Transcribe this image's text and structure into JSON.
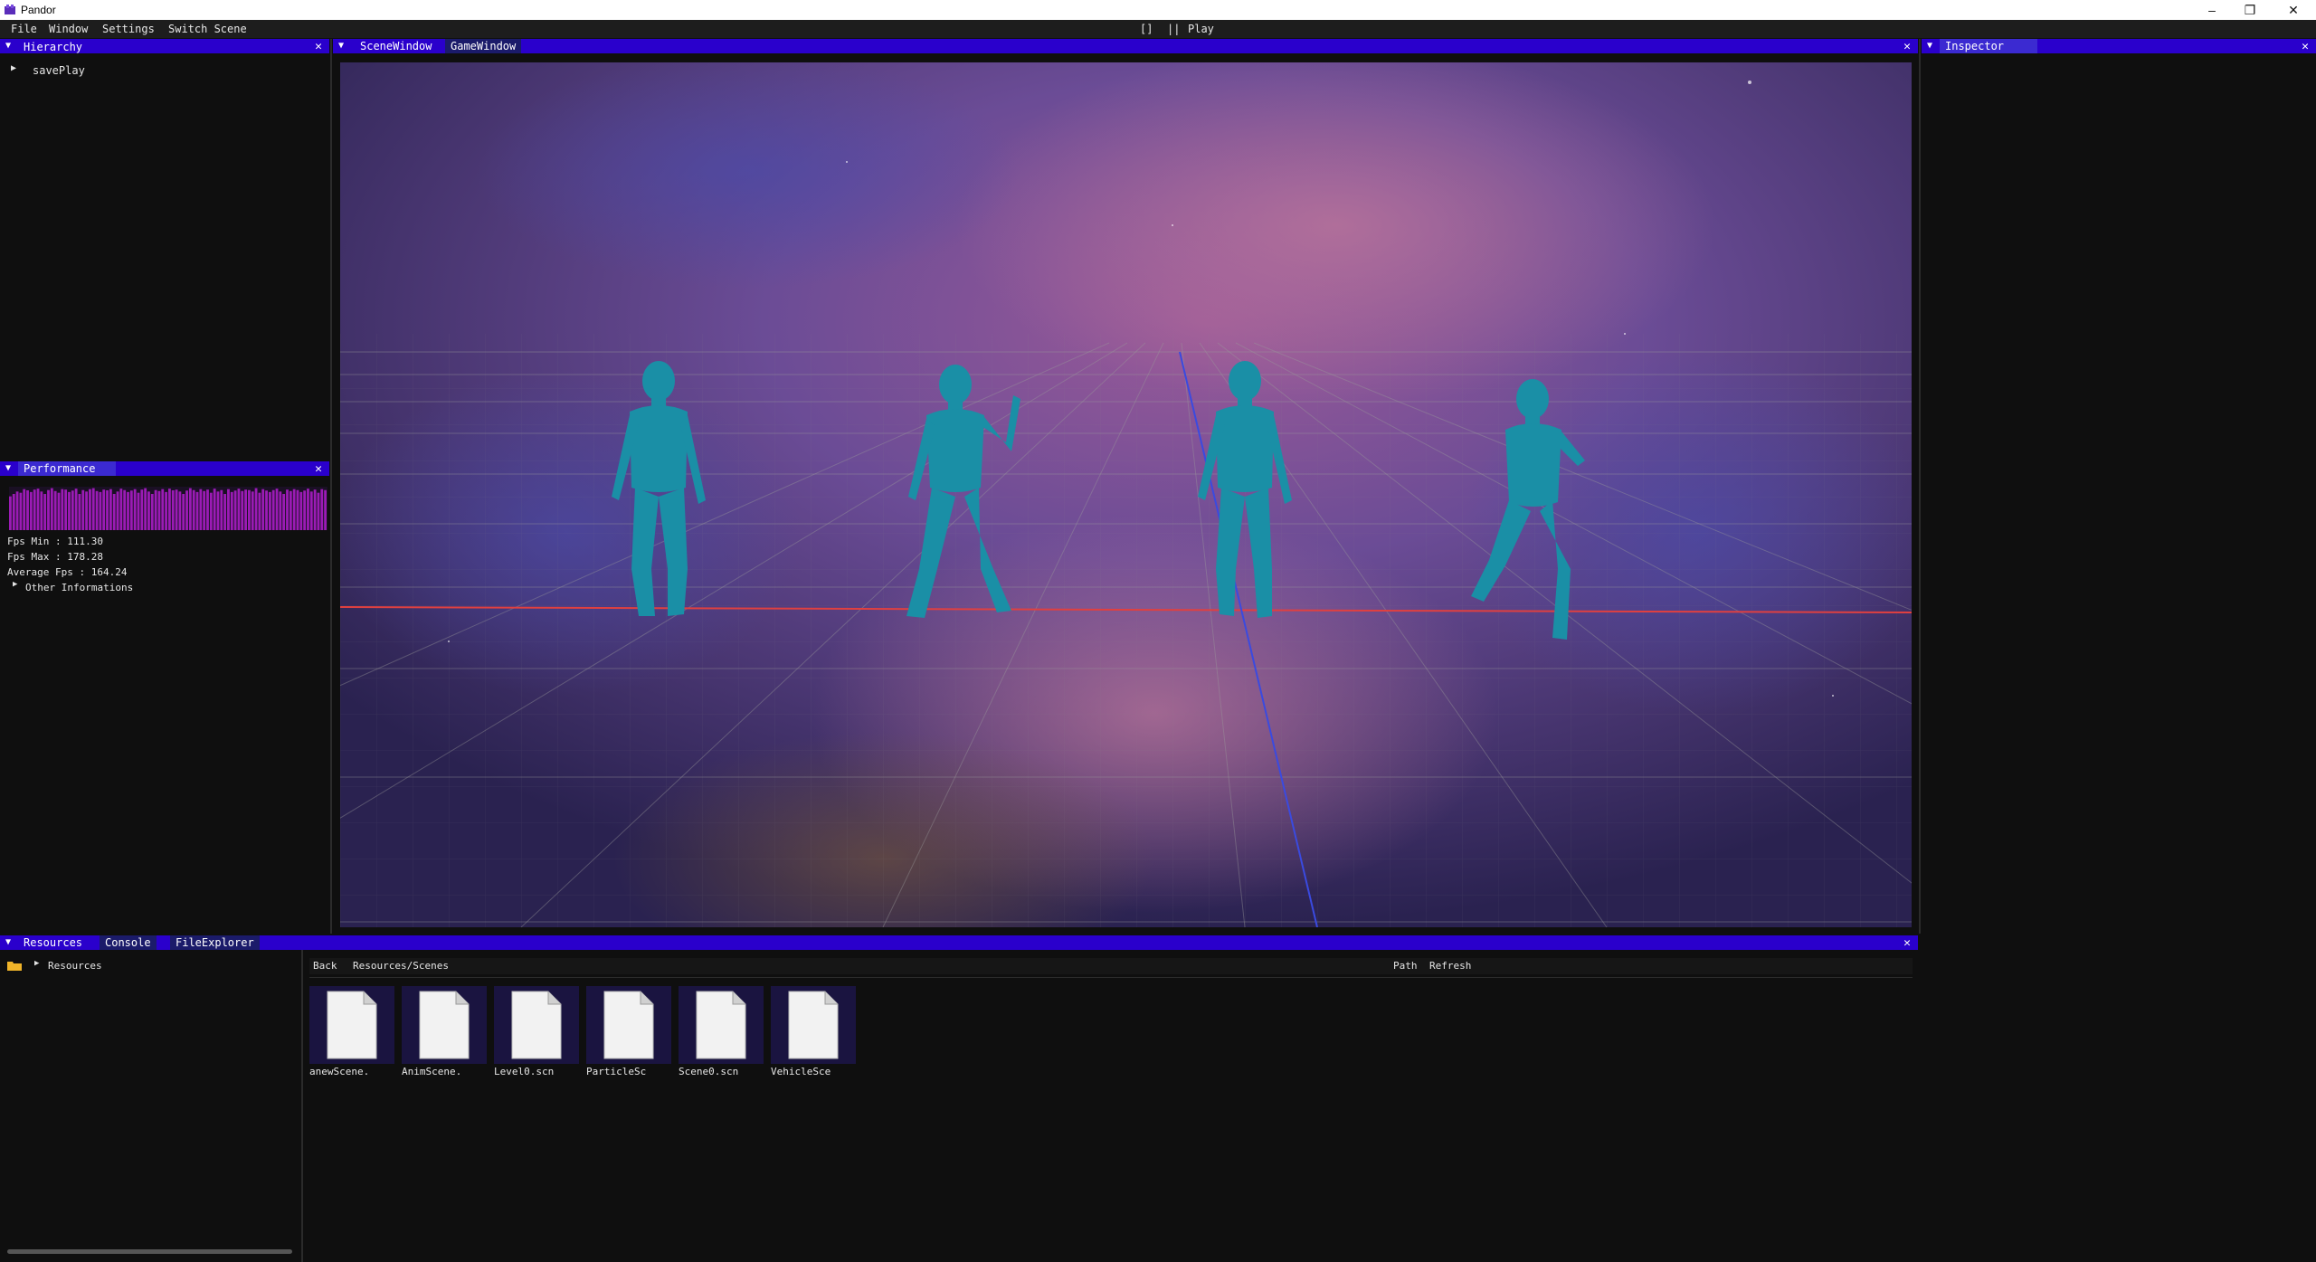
{
  "window": {
    "title": "Pandor",
    "minimize": "–",
    "maximize": "❐",
    "close": "✕"
  },
  "menubar": {
    "items": [
      "File",
      "Window",
      "Settings",
      "Switch Scene"
    ],
    "play_controls": {
      "stop": "[]",
      "pause": "||",
      "play": "Play"
    }
  },
  "hierarchy": {
    "title": "Hierarchy",
    "items": [
      {
        "label": "savePlay"
      }
    ]
  },
  "performance": {
    "title": "Performance",
    "fps_min": "Fps Min : 111.30",
    "fps_max": "Fps Max : 178.28",
    "avg_fps": "Average Fps : 164.24",
    "other_info": "Other Informations",
    "fps_history": [
      140,
      150,
      160,
      155,
      170,
      165,
      158,
      168,
      172,
      160,
      150,
      166,
      174,
      162,
      155,
      170,
      168,
      158,
      164,
      172,
      150,
      166,
      160,
      170,
      174,
      162,
      158,
      168,
      165,
      170,
      150,
      160,
      172,
      166,
      158,
      164,
      170,
      155,
      168,
      174,
      160,
      150,
      166,
      162,
      170,
      158,
      172,
      165,
      168,
      160,
      150,
      164,
      174,
      166,
      158,
      170,
      162,
      168,
      155,
      172,
      160,
      166,
      150,
      170,
      158,
      164,
      172,
      162,
      168,
      166,
      160,
      174,
      155,
      170,
      164,
      158,
      166,
      172,
      160,
      150,
      168,
      162,
      170,
      166,
      158,
      164,
      172,
      160,
      168,
      155,
      170,
      166
    ]
  },
  "viewport": {
    "tabs": [
      {
        "label": "SceneWindow"
      },
      {
        "label": "GameWindow"
      }
    ]
  },
  "inspector": {
    "title": "Inspector"
  },
  "bottom": {
    "tabs": [
      {
        "label": "Resources"
      },
      {
        "label": "Console"
      },
      {
        "label": "FileExplorer"
      }
    ],
    "tree": {
      "label": "Resources"
    },
    "toolbar": {
      "back": "Back",
      "path_text": "Resources/Scenes",
      "path_button": "Path",
      "refresh": "Refresh"
    },
    "files": [
      {
        "name": "anewScene."
      },
      {
        "name": "AnimScene."
      },
      {
        "name": "Level0.scn"
      },
      {
        "name": "ParticleSc"
      },
      {
        "name": "Scene0.scn"
      },
      {
        "name": "VehicleSce"
      }
    ]
  },
  "colors": {
    "accent": "#2a00cc",
    "tab_active": "#3b2ad1",
    "panel_bg": "#0f0f0f",
    "fps_graph": "#9b1bb5",
    "character": "#1a8fa6"
  }
}
